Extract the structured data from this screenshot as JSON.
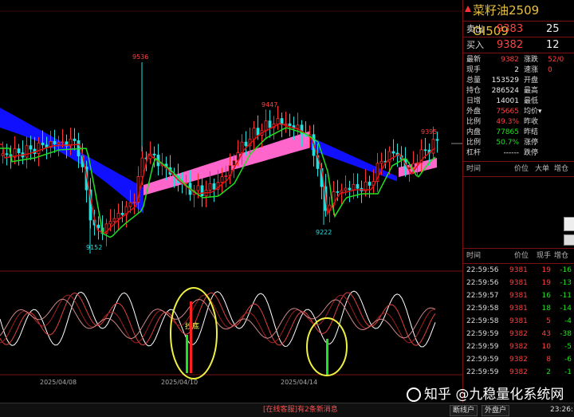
{
  "instrument": {
    "title": "菜籽油2509  OI509"
  },
  "quote": {
    "sell_label": "卖出",
    "sell_price": "9383",
    "sell_vol": "25",
    "buy_label": "买入",
    "buy_price": "9382",
    "buy_vol": "12"
  },
  "stats": [
    {
      "l": "最新",
      "v": "9382",
      "vc": "red",
      "l2": "涨跌",
      "v2": "52/0",
      "v2c": "red"
    },
    {
      "l": "现手",
      "v": "2",
      "vc": "white",
      "l2": "速涨",
      "v2": "0",
      "v2c": "red"
    },
    {
      "l": "总量",
      "v": "153529",
      "vc": "white",
      "l2": "开盘",
      "v2": "",
      "v2c": "red"
    },
    {
      "l": "持仓",
      "v": "286524",
      "vc": "white",
      "l2": "最高",
      "v2": "",
      "v2c": "red"
    },
    {
      "l": "日增",
      "v": "14001",
      "vc": "white",
      "l2": "最低",
      "v2": "",
      "v2c": "red"
    },
    {
      "l": "外盘",
      "v": "75665",
      "vc": "red",
      "l2": "均价▾",
      "v2": "",
      "v2c": "red"
    },
    {
      "l": "比例",
      "v": "49.3%",
      "vc": "red",
      "l2": "昨收",
      "v2": "",
      "v2c": "red"
    },
    {
      "l": "内盘",
      "v": "77865",
      "vc": "green",
      "l2": "昨结",
      "v2": "",
      "v2c": "red"
    },
    {
      "l": "比例",
      "v": "50.7%",
      "vc": "green",
      "l2": "涨停",
      "v2": "",
      "v2c": "red"
    },
    {
      "l": "杠杆",
      "v": "------",
      "vc": "white",
      "l2": "跌停",
      "v2": "",
      "v2c": "green"
    }
  ],
  "upper_table_headers": [
    "时间",
    "价位",
    "大单",
    "增仓"
  ],
  "trades_headers": [
    "时间",
    "价位",
    "现手",
    "增仓"
  ],
  "trades": [
    {
      "t": "22:59:56",
      "p": "9381",
      "q": "19",
      "qc": "red",
      "d": "-16"
    },
    {
      "t": "22:59:56",
      "p": "9381",
      "q": "19",
      "qc": "red",
      "d": "-13"
    },
    {
      "t": "22:59:57",
      "p": "9381",
      "q": "16",
      "qc": "green",
      "d": "-11"
    },
    {
      "t": "22:59:58",
      "p": "9381",
      "q": "18",
      "qc": "green",
      "d": "-14"
    },
    {
      "t": "22:59:58",
      "p": "9381",
      "q": "5",
      "qc": "red",
      "d": "-4"
    },
    {
      "t": "22:59:59",
      "p": "9382",
      "q": "43",
      "qc": "red",
      "d": "-38"
    },
    {
      "t": "22:59:59",
      "p": "9382",
      "q": "10",
      "qc": "red",
      "d": "-5"
    },
    {
      "t": "22:59:59",
      "p": "9382",
      "q": "8",
      "qc": "red",
      "d": "-6"
    },
    {
      "t": "22:59:59",
      "p": "9382",
      "q": "2",
      "qc": "green",
      "d": "-1"
    }
  ],
  "chart_labels": {
    "high1": "9536",
    "high2": "9447",
    "high3": "9395",
    "low1": "9152",
    "low2": "9222",
    "annotation": "抄底",
    "date1": "2025/04/08",
    "date2": "2025/04/10",
    "date3": "2025/04/14"
  },
  "statusbar": {
    "msg": "[在线客服]有2条新消息",
    "btn1": "断线户",
    "btn2": "外盘户",
    "time": "23:26:10"
  },
  "watermark": "知乎 @九稳量化系统网",
  "colors": {
    "up": "#ff3030",
    "down": "#20e0e0",
    "ribbon_bear": "#1010ff",
    "ribbon_bull": "#ff66cc",
    "ma_short": "#e01010",
    "ma_long": "#20e020"
  }
}
